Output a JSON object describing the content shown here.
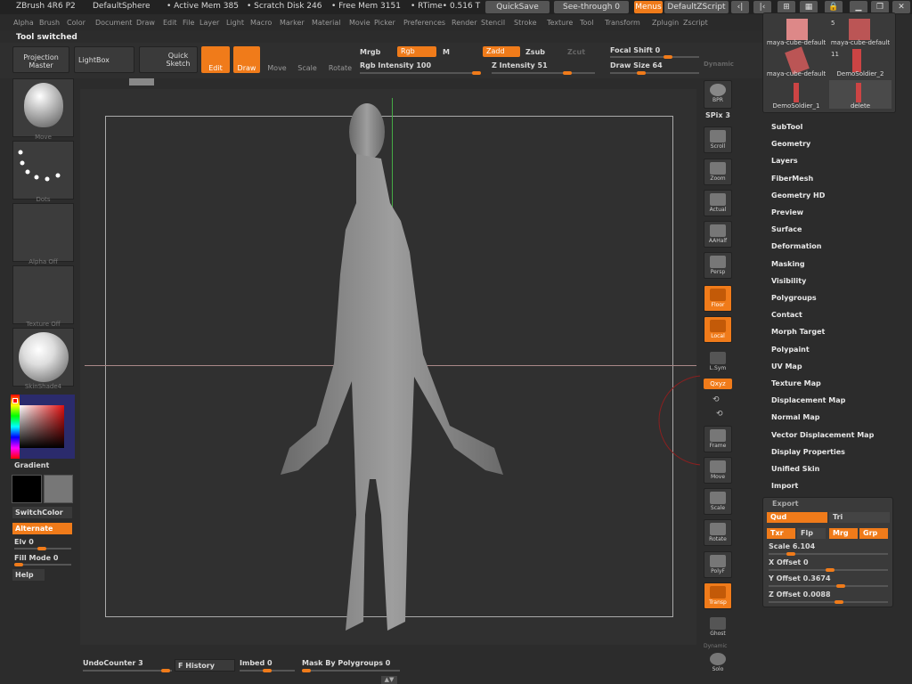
{
  "titlebar": {
    "app": "ZBrush 4R6 P2",
    "doc": "DefaultSphere",
    "active_mem": "• Active Mem 385",
    "scratch": "• Scratch Disk 246",
    "free_mem": "• Free Mem 3151",
    "rtime": "• RTime• 0.516 T",
    "quicksave": "QuickSave",
    "seethrough": "See-through  0",
    "menus": "Menus",
    "zscript": "DefaultZScript"
  },
  "menubar": [
    "Alpha",
    "Brush",
    "Color",
    "Document",
    "Draw",
    "Edit",
    "File",
    "Layer",
    "Light",
    "Macro",
    "Marker",
    "Material",
    "Movie",
    "Picker",
    "Preferences",
    "Render",
    "Stencil",
    "Stroke",
    "Texture",
    "Tool",
    "Transform",
    "Zplugin",
    "Zscript"
  ],
  "status": "Tool switched",
  "toolbar": {
    "projection_master": "Projection Master",
    "lightbox": "LightBox",
    "quick_sketch": "Quick Sketch",
    "edit": "Edit",
    "draw": "Draw",
    "move": "Move",
    "scale": "Scale",
    "rotate": "Rotate",
    "mrgb": "Mrgb",
    "rgb": "Rgb",
    "m": "M",
    "rgb_intensity": "Rgb  Intensity 100",
    "zadd": "Zadd",
    "zsub": "Zsub",
    "zcut": "Zcut",
    "z_intensity": "Z  Intensity 51",
    "focal_shift": "Focal Shift 0",
    "draw_size": "Draw Size 64",
    "dynamic": "Dynamic"
  },
  "left_shelf": {
    "brush": "Move",
    "stroke": "Dots",
    "alpha": "Alpha  Off",
    "texture": "Texture  Off",
    "material": "SkinShade4",
    "gradient": "Gradient",
    "switchcolor": "SwitchColor",
    "alternate": "Alternate",
    "elv": "Elv 0",
    "fill_mode": "Fill Mode 0",
    "help": "Help"
  },
  "right_shelf": {
    "bpr": "BPR",
    "spix": "SPix 3",
    "scroll": "Scroll",
    "zoom": "Zoom",
    "actual": "Actual",
    "aahalf": "AAHalf",
    "persp": "Persp",
    "floor": "Floor",
    "local": "Local",
    "lsym": "L.Sym",
    "xyz": "Qxyz",
    "frame": "Frame",
    "move": "Move",
    "scale": "Scale",
    "rotate": "Rotate",
    "polyf": "PolyF",
    "transp": "Transp",
    "ghost": "Ghost",
    "dynamic": "Dynamic",
    "solo": "Solo"
  },
  "subtools": {
    "count": "5",
    "count2": "11",
    "items": [
      "maya-cube-default",
      "maya-cube-default",
      "maya-cube-default",
      "DemoSoldier_2",
      "DemoSoldier_1",
      "delete"
    ]
  },
  "tool_menu": [
    "SubTool",
    "Geometry",
    "Layers",
    "FiberMesh",
    "Geometry HD",
    "Preview",
    "Surface",
    "Deformation",
    "Masking",
    "Visibility",
    "Polygroups",
    "Contact",
    "Morph Target",
    "Polypaint",
    "UV Map",
    "Texture Map",
    "Displacement Map",
    "Normal Map",
    "Vector Displacement Map",
    "Display Properties",
    "Unified Skin",
    "Import"
  ],
  "export": {
    "title": "Export",
    "qud": "Qud",
    "tri": "Tri",
    "txr": "Txr",
    "flp": "Flp",
    "mrg": "Mrg",
    "grp": "Grp",
    "scale": "Scale 6.104",
    "x_offset": "X Offset 0",
    "y_offset": "Y Offset 0.3674",
    "z_offset": "Z Offset 0.0088"
  },
  "bottom": {
    "undo": "UndoCounter 3",
    "history": "F History",
    "imbed": "Imbed 0",
    "mask": "Mask By Polygroups 0"
  },
  "colors": {
    "accent": "#f07b1a",
    "bg": "#2c2c2c",
    "panel": "#3a3a3a"
  }
}
